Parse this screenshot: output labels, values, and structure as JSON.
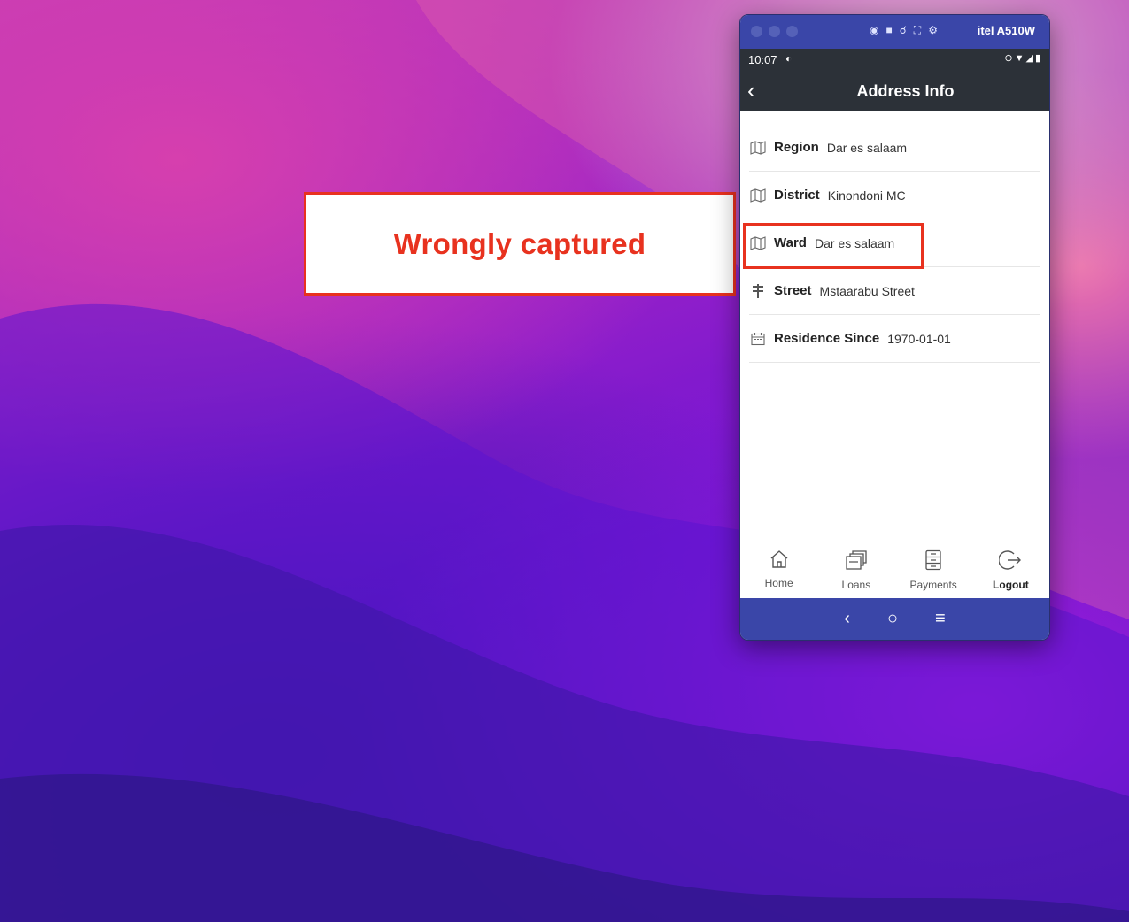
{
  "annotation": {
    "text": "Wrongly captured"
  },
  "window": {
    "device_name": "itel A510W",
    "toolbar_icons": [
      "camera-icon",
      "video-icon",
      "headphones-icon",
      "fullscreen-icon",
      "settings-icon"
    ]
  },
  "status_bar": {
    "time": "10:07"
  },
  "app_bar": {
    "title": "Address Info"
  },
  "address": {
    "items": [
      {
        "label": "Region",
        "value": "Dar es salaam",
        "icon": "map-icon"
      },
      {
        "label": "District",
        "value": "Kinondoni MC",
        "icon": "map-icon"
      },
      {
        "label": "Ward",
        "value": "Dar es salaam",
        "icon": "map-icon"
      },
      {
        "label": "Street",
        "value": "Mstaarabu Street",
        "icon": "signpost-icon"
      },
      {
        "label": "Residence Since",
        "value": "1970-01-01",
        "icon": "calendar-icon"
      }
    ]
  },
  "bottom_nav": {
    "items": [
      {
        "label": "Home",
        "icon": "home-icon"
      },
      {
        "label": "Loans",
        "icon": "loans-icon"
      },
      {
        "label": "Payments",
        "icon": "payments-icon"
      },
      {
        "label": "Logout",
        "icon": "logout-icon"
      }
    ]
  },
  "colors": {
    "accent_red": "#e8321f",
    "window_chrome": "#3a46a8",
    "app_bar": "#2c3138"
  }
}
